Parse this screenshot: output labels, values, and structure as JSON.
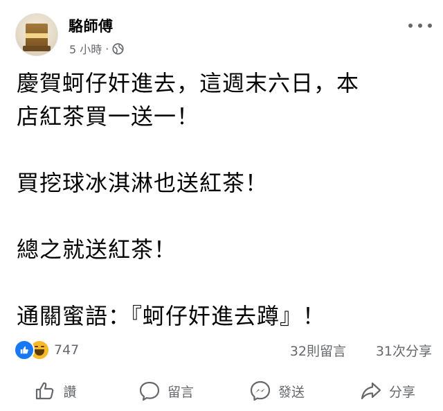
{
  "header": {
    "page_name": "駱師傅",
    "time": "5 小時",
    "separator": "·",
    "audience_icon": "globe-icon",
    "more_icon": "more-options-icon",
    "avatar_icon": "page-avatar"
  },
  "post": {
    "paragraphs": [
      "慶賀蚵仔奸進去，這週末六日，本\n店紅茶買一送一！",
      "買挖球冰淇淋也送紅茶！",
      "總之就送紅茶！",
      "通關蜜語：『蚵仔奸進去蹲』！"
    ]
  },
  "stats": {
    "reaction_icons": [
      "like-reaction-icon",
      "haha-reaction-icon"
    ],
    "reaction_count": "747",
    "comments": "32則留言",
    "shares": "31次分享"
  },
  "actions": [
    {
      "label": "讚",
      "icon": "thumbs-up-icon"
    },
    {
      "label": "留言",
      "icon": "comment-bubble-icon"
    },
    {
      "label": "發送",
      "icon": "messenger-icon"
    },
    {
      "label": "分享",
      "icon": "share-arrow-icon"
    }
  ],
  "colors": {
    "text": "#050505",
    "secondary": "#65676b",
    "like_blue": "#1877f2",
    "haha_yellow": "#f7b928"
  }
}
